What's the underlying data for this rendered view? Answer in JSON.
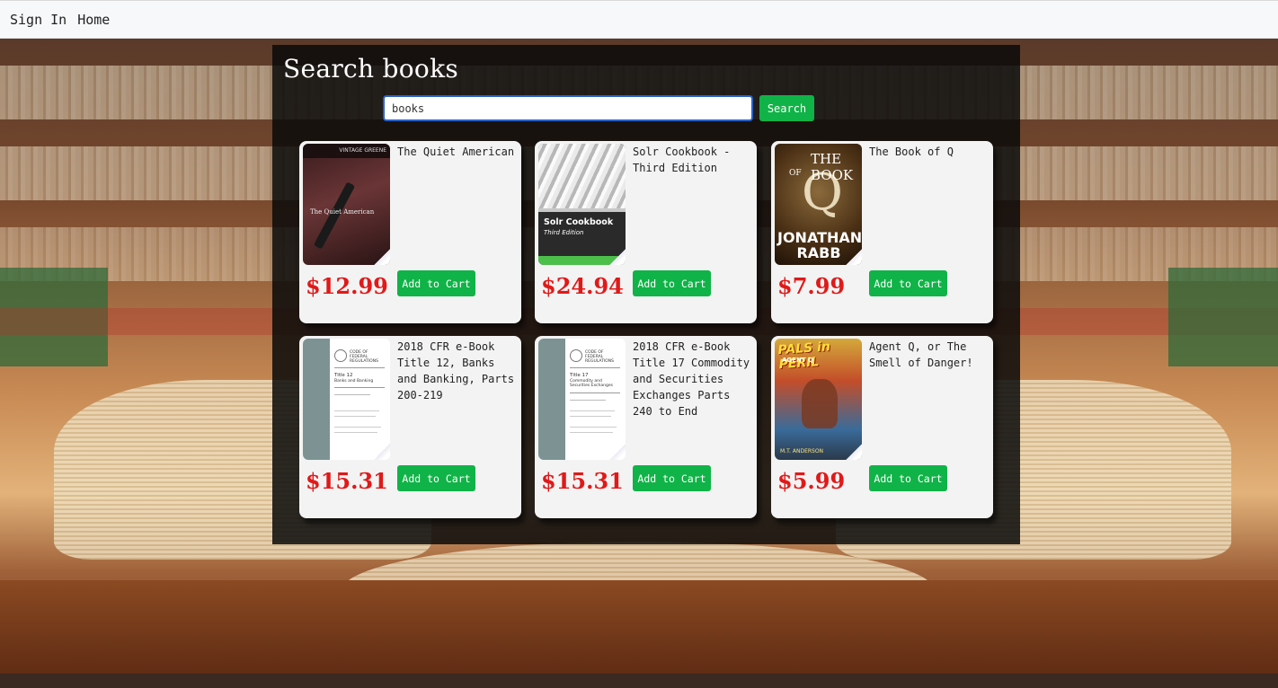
{
  "nav": {
    "sign_in": "Sign In",
    "home": "Home"
  },
  "page": {
    "title": "Search books"
  },
  "search": {
    "value": "books",
    "button": "Search"
  },
  "results": [
    {
      "title": "The Quiet American",
      "price": "$12.99",
      "button": "Add to Cart",
      "cover": "the-quiet-american-cover",
      "cover_text": {
        "publisher": "VINTAGE GREENE",
        "caption": "The Quiet American"
      }
    },
    {
      "title": "Solr Cookbook - Third Edition",
      "price": "$24.94",
      "button": "Add to Cart",
      "cover": "solr-cookbook-cover",
      "cover_text": {
        "title": "Solr Cookbook",
        "subtitle": "Third Edition"
      }
    },
    {
      "title": "The Book of Q",
      "price": "$7.99",
      "button": "Add to Cart",
      "cover": "the-book-of-q-cover",
      "cover_text": {
        "book": "THE BOOK",
        "of": "OF",
        "q": "Q",
        "author": "JONATHAN RABB"
      }
    },
    {
      "title": "2018 CFR e-Book Title 12, Banks and Banking, Parts 200-219",
      "price": "$15.31",
      "button": "Add to Cart",
      "cover": "cfr-title-12-cover",
      "cover_text": {
        "header": "CODE OF FEDERAL REGULATIONS",
        "title": "Title 12",
        "subtitle": "Banks and Banking"
      }
    },
    {
      "title": "2018 CFR e-Book Title 17 Commodity and Securities Exchanges Parts 240 to End",
      "price": "$15.31",
      "button": "Add to Cart",
      "cover": "cfr-title-17-cover",
      "cover_text": {
        "header": "CODE OF FEDERAL REGULATIONS",
        "title": "Title 17",
        "subtitle": "Commodity and Securities Exchanges"
      }
    },
    {
      "title": "Agent Q, or The Smell of Danger!",
      "price": "$5.99",
      "button": "Add to Cart",
      "cover": "agent-q-cover",
      "cover_text": {
        "series": "PALS in PERIL",
        "sub": "AGENT Q",
        "author": "M.T. ANDERSON"
      }
    }
  ],
  "colors": {
    "accent_green": "#10b347",
    "price_red": "#e11919",
    "input_border": "#2a62c8"
  }
}
